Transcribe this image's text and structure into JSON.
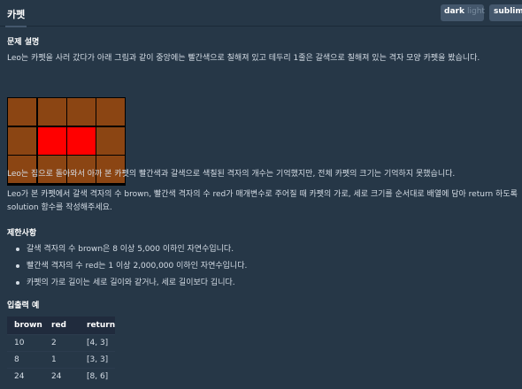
{
  "header": {
    "tab_label": "카펫",
    "theme_dark": "dark",
    "theme_light": "light",
    "editor_theme": "sublime"
  },
  "problem": {
    "section_title": "문제 설명",
    "intro": "Leo는 카펫을 사러 갔다가 아래 그림과 같이 중앙에는 빨간색으로 칠해져 있고 테두리 1줄은 갈색으로 칠해져 있는 격자 모양 카펫을 봤습니다.",
    "para2": "Leo는 집으로 돌아와서 아까 본 카펫의 빨간색과 갈색으로 색칠된 격자의 개수는 기억했지만, 전체 카펫의 크기는 기억하지 못했습니다.",
    "para3_line1": "Leo가 본 카펫에서 갈색 격자의 수 brown, 빨간색 격자의 수 red가 매개변수로 주어질 때 카펫의 가로, 세로 크기를 순서대로 배열에 담아 return 하도록",
    "para3_line2": "solution 함수를 작성해주세요.",
    "carpet_colors": {
      "border": "#8b4513",
      "center": "#ff0000"
    }
  },
  "constraints": {
    "section_title": "제한사항",
    "items": [
      "갈색 격자의 수 brown은 8 이상 5,000 이하인 자연수입니다.",
      "빨간색 격자의 수 red는 1 이상 2,000,000 이하인 자연수입니다.",
      "카펫의 가로 길이는 세로 길이와 같거나, 세로 길이보다 깁니다."
    ]
  },
  "examples": {
    "section_title": "입출력 예",
    "headers": [
      "brown",
      "red",
      "return"
    ],
    "rows": [
      [
        "10",
        "2",
        "[4, 3]"
      ],
      [
        "8",
        "1",
        "[3, 3]"
      ],
      [
        "24",
        "24",
        "[8, 6]"
      ]
    ]
  }
}
